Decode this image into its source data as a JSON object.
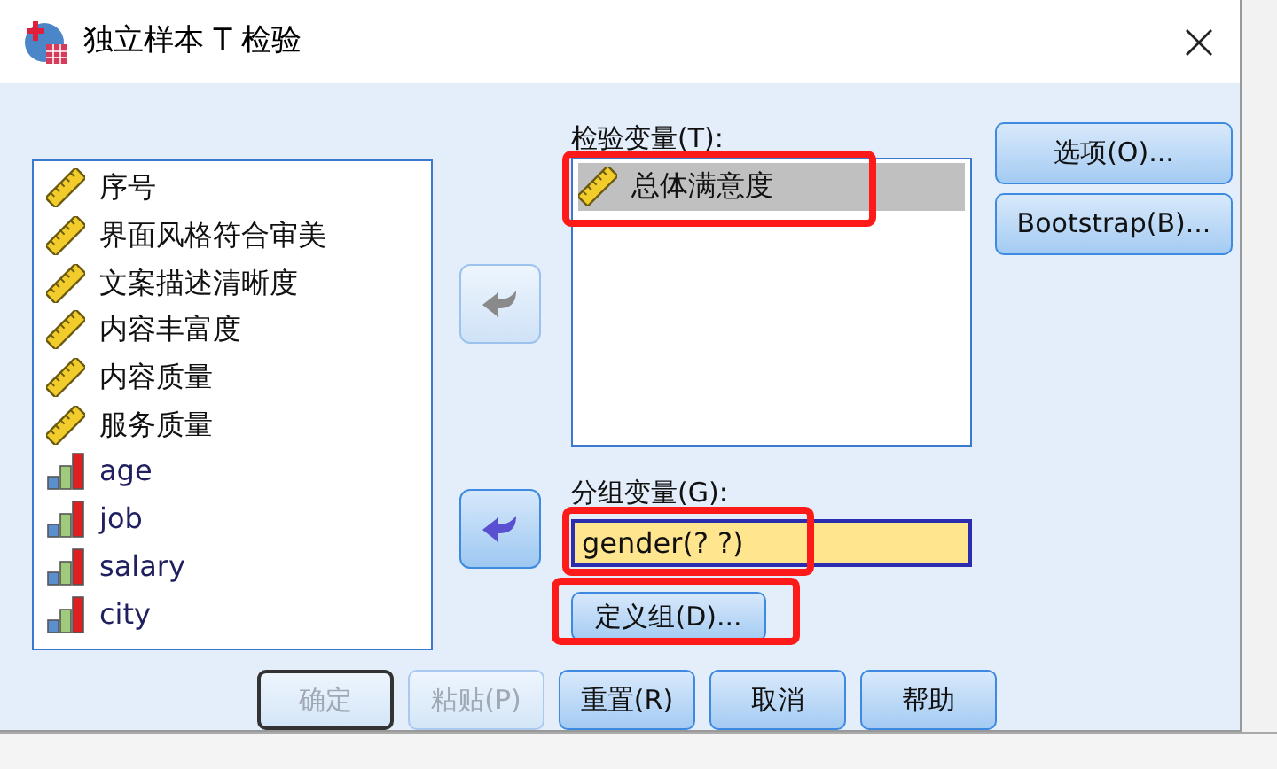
{
  "window": {
    "title": "独立样本 T 检验"
  },
  "source_variables": [
    {
      "label": "序号",
      "kind": "scale",
      "selected": false
    },
    {
      "label": "界面风格符合审美",
      "kind": "scale",
      "selected": false
    },
    {
      "label": "文案描述清晰度",
      "kind": "scale",
      "selected": false
    },
    {
      "label": "内容丰富度",
      "kind": "scale",
      "selected": false
    },
    {
      "label": "内容质量",
      "kind": "scale",
      "selected": false
    },
    {
      "label": "服务质量",
      "kind": "scale",
      "selected": false
    },
    {
      "label": "age",
      "kind": "ordinal",
      "selected": false
    },
    {
      "label": "job",
      "kind": "ordinal",
      "selected": false
    },
    {
      "label": "salary",
      "kind": "ordinal",
      "selected": false
    },
    {
      "label": "city",
      "kind": "ordinal",
      "selected": false
    }
  ],
  "move_buttons": [
    {
      "disabled": true
    },
    {
      "disabled": false
    }
  ],
  "test_variables": {
    "label": "检验变量(T):",
    "highlighted": true,
    "items": [
      {
        "label": "总体满意度",
        "kind": "scale",
        "selected": true
      }
    ]
  },
  "grouping_variable": {
    "label": "分组变量(G):",
    "value": "gender(? ?)",
    "highlighted": true
  },
  "define_groups_button": {
    "label": "定义组(D)...",
    "highlighted": true
  },
  "side_buttons": [
    {
      "label": "选项(O)..."
    },
    {
      "label": "Bootstrap(B)..."
    }
  ],
  "footer_buttons": [
    {
      "label": "确定",
      "disabled": true,
      "default": true
    },
    {
      "label": "粘贴(P)",
      "disabled": true,
      "default": false
    },
    {
      "label": "重置(R)",
      "disabled": false,
      "default": false
    },
    {
      "label": "取消",
      "disabled": false,
      "default": false
    },
    {
      "label": "帮助",
      "disabled": false,
      "default": false
    }
  ]
}
